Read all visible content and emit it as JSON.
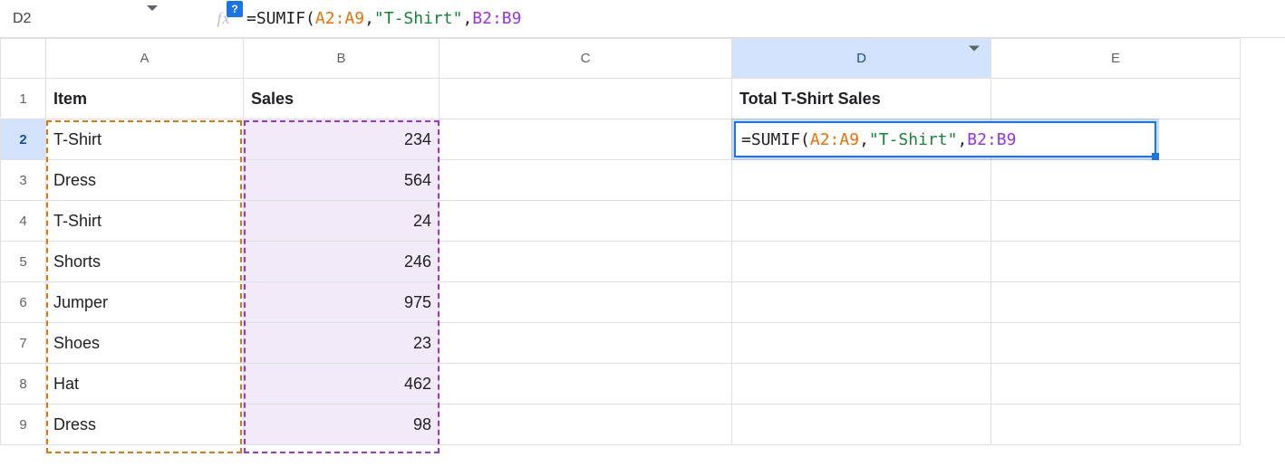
{
  "namebox": {
    "value": "D2"
  },
  "fx_label": "fx",
  "help_badge": "?",
  "formula": {
    "prefix": "=",
    "fn": "SUMIF",
    "open": "(",
    "arg1": "A2:A9",
    "sep1": ",",
    "arg2": "\"T-Shirt\"",
    "sep2": ",",
    "arg3": "B2:B9"
  },
  "columns": [
    "A",
    "B",
    "C",
    "D",
    "E"
  ],
  "selected_column": "D",
  "selected_row": "2",
  "row_headers": [
    "1",
    "2",
    "3",
    "4",
    "5",
    "6",
    "7",
    "8",
    "9"
  ],
  "headers": {
    "A1": "Item",
    "B1": "Sales",
    "D1": "Total T-Shirt Sales"
  },
  "data": {
    "A": [
      "T-Shirt",
      "Dress",
      "T-Shirt",
      "Shorts",
      "Jumper",
      "Shoes",
      "Hat",
      "Dress"
    ],
    "B": [
      "234",
      "564",
      "24",
      "246",
      "975",
      "23",
      "462",
      "98"
    ]
  },
  "range_colors": {
    "a": "#E8710A",
    "b": "#9334E6"
  }
}
